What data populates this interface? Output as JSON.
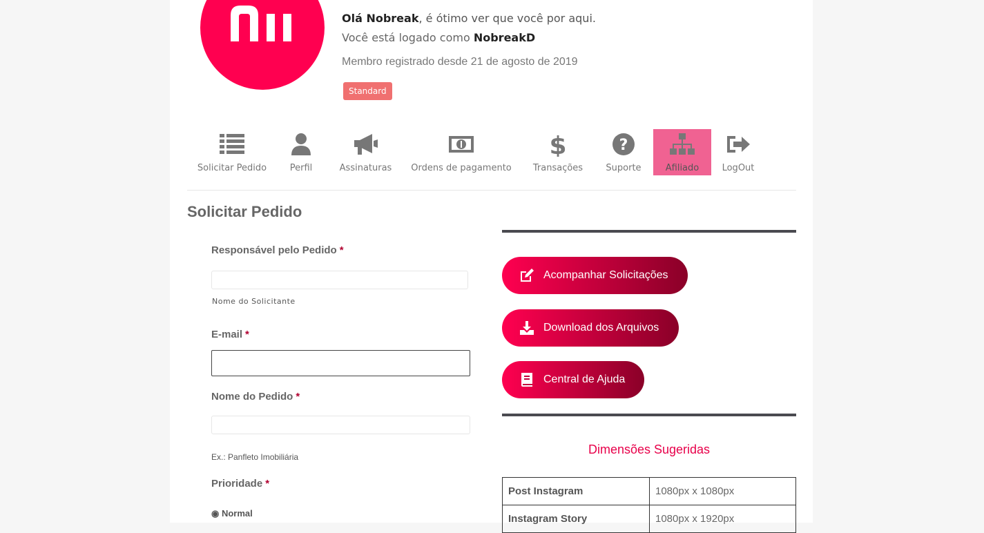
{
  "header": {
    "greeting_name": "Olá Nobreak",
    "greeting_rest": ", é ótimo ver que você por aqui.",
    "logged_prefix": "Você está logado como",
    "username": "NobreakD",
    "member_since": "Membro registrado desde 21 de agosto de 2019",
    "plan_badge": "Standard"
  },
  "nav": {
    "items": [
      {
        "label": "Solicitar Pedido",
        "icon": "list-icon"
      },
      {
        "label": "Perfil",
        "icon": "user-icon"
      },
      {
        "label": "Assinaturas",
        "icon": "megaphone-icon"
      },
      {
        "label": "Ordens de pagamento",
        "icon": "money-bill-icon"
      },
      {
        "label": "Transações",
        "icon": "dollar-icon"
      },
      {
        "label": "Suporte",
        "icon": "question-circle-icon"
      },
      {
        "label": "Afiliado",
        "icon": "sitemap-icon"
      },
      {
        "label": "LogOut",
        "icon": "sign-out-icon"
      }
    ],
    "active": "Afiliado",
    "active_color": "#f06292"
  },
  "form": {
    "title": "Solicitar Pedido",
    "responsavel_label": "Responsável pelo Pedido",
    "responsavel_hint": "Nome do Solicitante",
    "email_label": "E-mail",
    "nome_pedido_label": "Nome do Pedido",
    "nome_pedido_hint": "Ex.: Panfleto Imobiliária",
    "prioridade_label": "Prioridade",
    "prioridade_option": "Normal",
    "required_mark": "*"
  },
  "actions": {
    "acompanhar": "Acompanhar Solicitações",
    "download": "Download dos Arquivos",
    "ajuda": "Central de Ajuda"
  },
  "dimensions": {
    "title": "Dimensões Sugeridas",
    "rows": [
      {
        "name": "Post Instagram",
        "size": "1080px x 1080px"
      },
      {
        "name": "Instagram Story",
        "size": "1080px x 1920px"
      }
    ]
  },
  "colors": {
    "brand": "#ff0050",
    "badge": "#f07070"
  }
}
